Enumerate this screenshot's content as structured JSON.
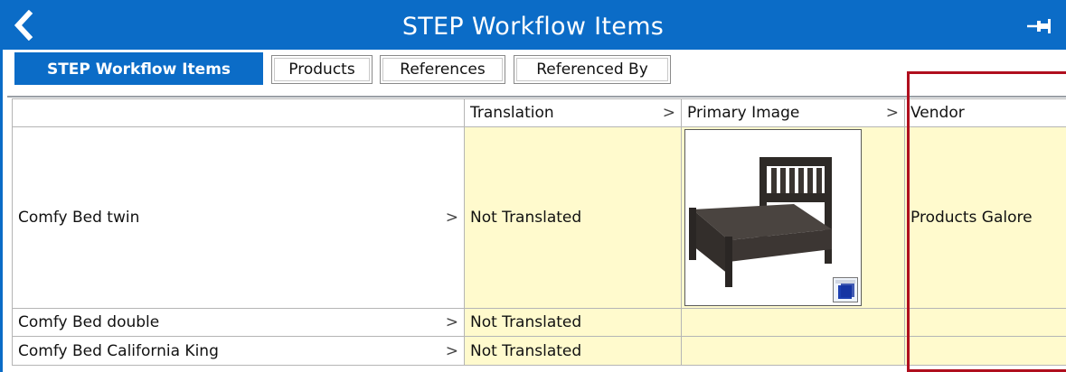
{
  "titlebar": {
    "title": "STEP Workflow Items",
    "back_icon": "chevron-left-icon",
    "pin_icon": "pin-icon",
    "color": "#0b6cc7"
  },
  "tabs": [
    {
      "label": "STEP Workflow Items",
      "active": true
    },
    {
      "label": "Products",
      "active": false
    },
    {
      "label": "References",
      "active": false
    },
    {
      "label": "Referenced By",
      "active": false
    }
  ],
  "table": {
    "columns": [
      "",
      "Translation",
      "Primary Image",
      "Vendor"
    ],
    "rows": [
      {
        "name": "Comfy Bed twin",
        "translation": "Not Translated",
        "vendor": "Products Galore",
        "has_image": true
      },
      {
        "name": "Comfy Bed double",
        "translation": "Not Translated",
        "vendor": "",
        "has_image": false
      },
      {
        "name": "Comfy Bed California King",
        "translation": "Not Translated",
        "vendor": "",
        "has_image": false
      }
    ],
    "chevron": ">"
  },
  "colors": {
    "cell_highlight": "#fffacd",
    "annotation_box": "#b00f1e"
  }
}
